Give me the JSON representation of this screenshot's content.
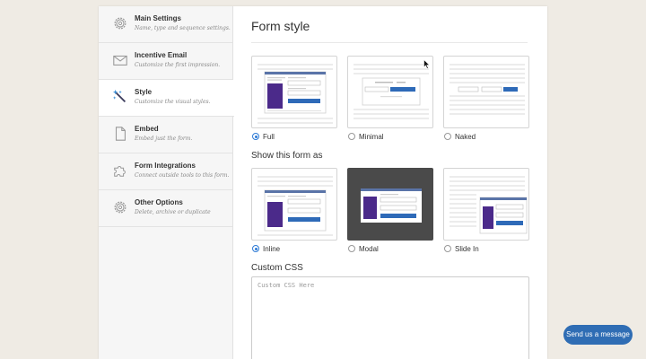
{
  "sidebar": {
    "items": [
      {
        "title": "Main Settings",
        "subtitle": "Name, type and sequence settings.",
        "icon": "gear-icon"
      },
      {
        "title": "Incentive Email",
        "subtitle": "Customize the first impression.",
        "icon": "envelope-icon"
      },
      {
        "title": "Style",
        "subtitle": "Customize the visual styles.",
        "icon": "magic-wand-icon",
        "active": true
      },
      {
        "title": "Embed",
        "subtitle": "Embed just the form.",
        "icon": "document-icon"
      },
      {
        "title": "Form Integrations",
        "subtitle": "Connect outside tools to this form.",
        "icon": "puzzle-icon"
      },
      {
        "title": "Other Options",
        "subtitle": "Delete, archive or duplicate",
        "icon": "gear-icon"
      }
    ]
  },
  "main": {
    "title": "Form style",
    "form_style_options": [
      {
        "label": "Full",
        "selected": true
      },
      {
        "label": "Minimal",
        "selected": false
      },
      {
        "label": "Naked",
        "selected": false
      }
    ],
    "show_as_label": "Show this form as",
    "show_as_options": [
      {
        "label": "Inline",
        "selected": true
      },
      {
        "label": "Modal",
        "selected": false
      },
      {
        "label": "Slide In",
        "selected": false
      }
    ],
    "custom_css_label": "Custom CSS",
    "custom_css_placeholder": "Custom CSS Here"
  },
  "chat": {
    "label": "Send us a message"
  },
  "colors": {
    "accent": "#2e7bd6",
    "chat_button": "#2f6db4",
    "form_purple": "#4b2a8a",
    "form_bar": "#5a74a8"
  }
}
